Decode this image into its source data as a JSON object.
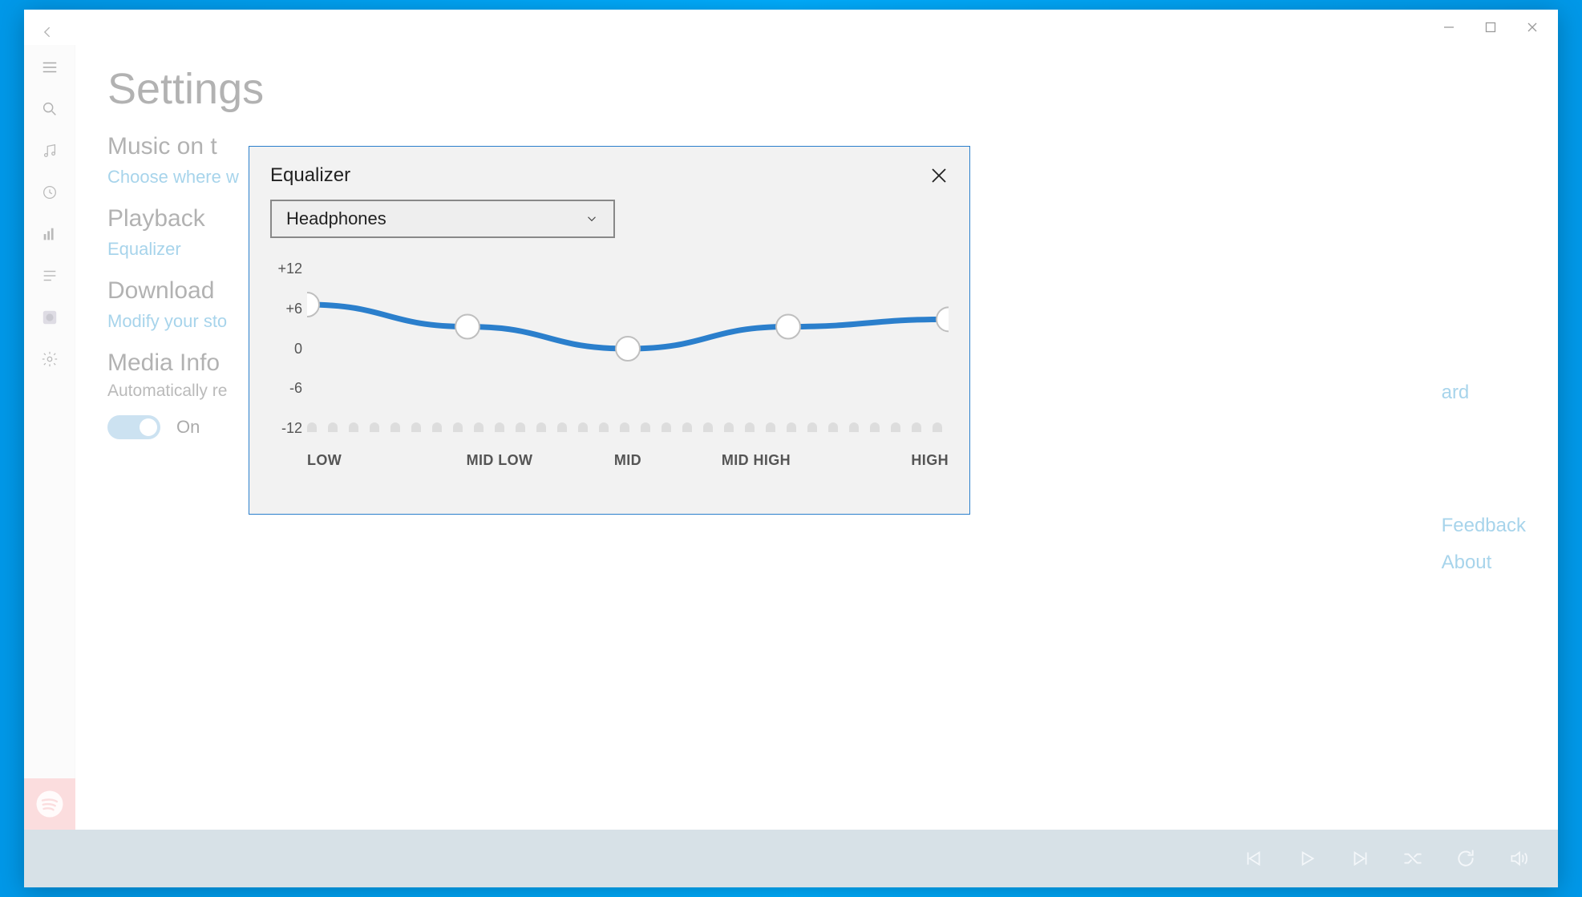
{
  "page_title": "Settings",
  "sections": {
    "music_on": {
      "heading": "Music on t",
      "link": "Choose where w"
    },
    "playback": {
      "heading": "Playback",
      "link": "Equalizer"
    },
    "downloads": {
      "heading": "Download",
      "link": "Modify your sto"
    },
    "media_info": {
      "heading": "Media Info",
      "sub": "Automatically re",
      "toggle_label": "On"
    }
  },
  "right_links": {
    "card_fragment": "ard",
    "feedback": "Feedback",
    "about": "About"
  },
  "dialog": {
    "title": "Equalizer",
    "preset": "Headphones"
  },
  "chart_data": {
    "type": "line",
    "title": "Equalizer",
    "xlabel": "",
    "ylabel": "",
    "ylim": [
      -12,
      12
    ],
    "y_ticks": [
      "+12",
      "+6",
      "0",
      "-6",
      "-12"
    ],
    "categories": [
      "LOW",
      "MID LOW",
      "MID",
      "MID HIGH",
      "HIGH"
    ],
    "values": [
      6,
      3,
      0,
      3,
      4
    ]
  }
}
